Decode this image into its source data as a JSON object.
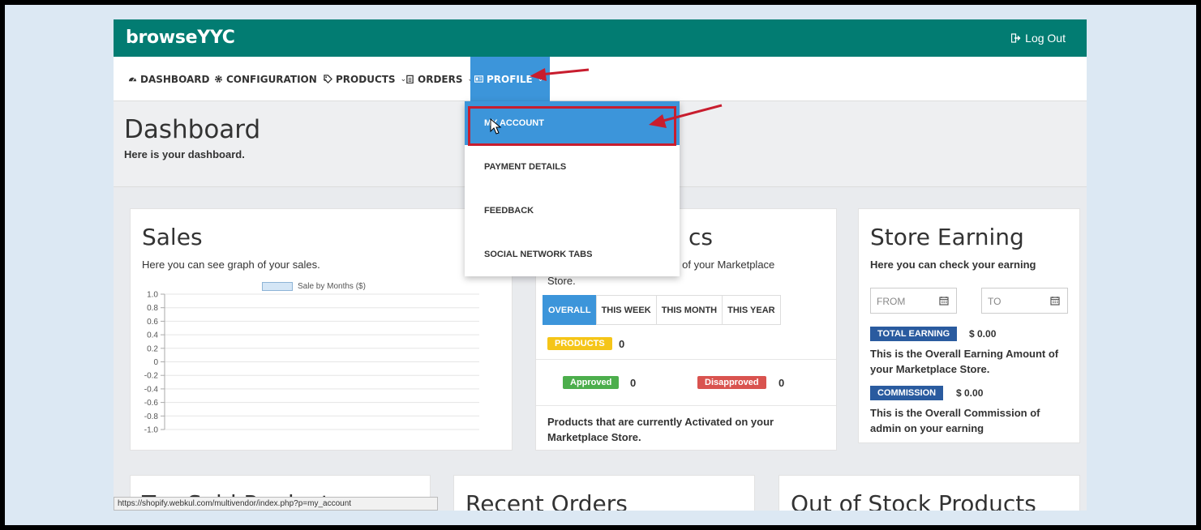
{
  "app": {
    "brand": "browseYYC",
    "logout_label": "Log Out"
  },
  "nav": {
    "dashboard": "DASHBOARD",
    "configuration": "CONFIGURATION",
    "products": "PRODUCTS",
    "orders": "ORDERS",
    "profile": "PROFILE"
  },
  "profile_menu": {
    "items": [
      "MY ACCOUNT",
      "PAYMENT DETAILS",
      "FEEDBACK",
      "SOCIAL NETWORK TABS"
    ],
    "selected": "MY ACCOUNT"
  },
  "page": {
    "title": "Dashboard",
    "subtitle": "Here is your dashboard."
  },
  "sales": {
    "title": "Sales",
    "subtitle": "Here you can see graph of your sales."
  },
  "chart_data": {
    "type": "line",
    "legend": [
      "Sale by Months ($)"
    ],
    "series": [
      {
        "name": "Sale by Months ($)",
        "values": []
      }
    ],
    "y_ticks": [
      "1.0",
      "0.8",
      "0.6",
      "0.4",
      "0.2",
      "0",
      "-0.2",
      "-0.4",
      "-0.6",
      "-0.8",
      "-1.0"
    ],
    "ylim": [
      -1.0,
      1.0
    ],
    "grid": true,
    "legend_position": "top"
  },
  "statistics": {
    "title_fragment": "cs",
    "subtitle_fragment": "s of your Marketplace",
    "subtitle_line2": "Store.",
    "tabs": [
      "OVERALL",
      "THIS WEEK",
      "THIS MONTH",
      "THIS YEAR"
    ],
    "active_tab": "OVERALL",
    "products_label": "PRODUCTS",
    "products_count": "0",
    "approved_label": "Approved",
    "approved_count": "0",
    "disapproved_label": "Disapproved",
    "disapproved_count": "0",
    "footer": "Products that are currently Activated on your Marketplace Store."
  },
  "earning": {
    "title": "Store Earning",
    "subtitle": "Here you can check your earning",
    "from_placeholder": "FROM",
    "to_placeholder": "TO",
    "total_label": "TOTAL EARNING",
    "total_amount": "$ 0.00",
    "total_desc": "This is the Overall Earning Amount of your Marketplace Store.",
    "commission_label": "COMMISSION",
    "commission_amount": "$ 0.00",
    "commission_desc": "This is the Overall Commission of admin on your earning"
  },
  "bottom": {
    "top_sold": "Top Sold Products",
    "recent_orders": "Recent Orders",
    "out_of_stock": "Out of Stock Products"
  },
  "status_url": "https://shopify.webkul.com/multivendor/index.php?p=my_account",
  "colors": {
    "topbar": "#027c72",
    "active_blue": "#3c95da",
    "products_badge": "#f5c518",
    "approved": "#4cae4c",
    "disapproved": "#d9534f",
    "tag_blue": "#2a5b9f",
    "annotation_red": "#c81d2e"
  }
}
